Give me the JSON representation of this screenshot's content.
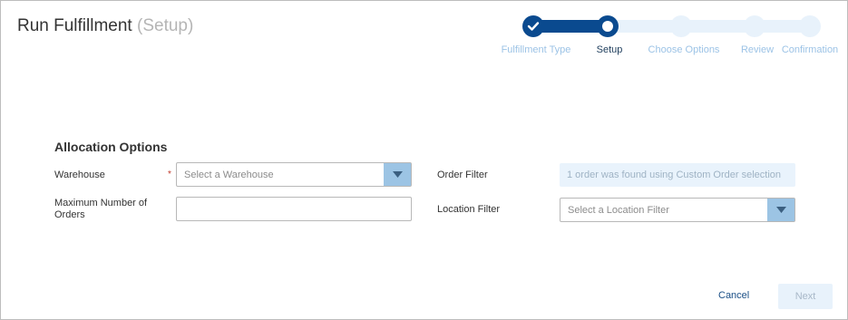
{
  "header": {
    "title": "Run Fulfillment",
    "subtitle": "(Setup)"
  },
  "wizard": {
    "steps": [
      {
        "label": "Fulfillment Type",
        "state": "complete"
      },
      {
        "label": "Setup",
        "state": "current"
      },
      {
        "label": "Choose Options",
        "state": "upcoming"
      },
      {
        "label": "Review",
        "state": "upcoming"
      },
      {
        "label": "Confirmation",
        "state": "upcoming"
      }
    ]
  },
  "form": {
    "section_title": "Allocation Options",
    "warehouse": {
      "label": "Warehouse",
      "required_mark": "*",
      "placeholder": "Select a Warehouse"
    },
    "max_orders": {
      "label": "Maximum Number of Orders",
      "value": ""
    },
    "order_filter": {
      "label": "Order Filter",
      "value": "1 order was found using Custom Order selection"
    },
    "location_filter": {
      "label": "Location Filter",
      "placeholder": "Select a Location Filter"
    }
  },
  "footer": {
    "cancel_label": "Cancel",
    "next_label": "Next"
  },
  "colors": {
    "primary": "#0a4a8f",
    "track_light": "#e8f2fb",
    "dropdown_button": "#9cc4e4",
    "required": "#c0392b"
  },
  "icons": {
    "completed_step": "check-icon",
    "dropdown": "chevron-down-icon"
  }
}
